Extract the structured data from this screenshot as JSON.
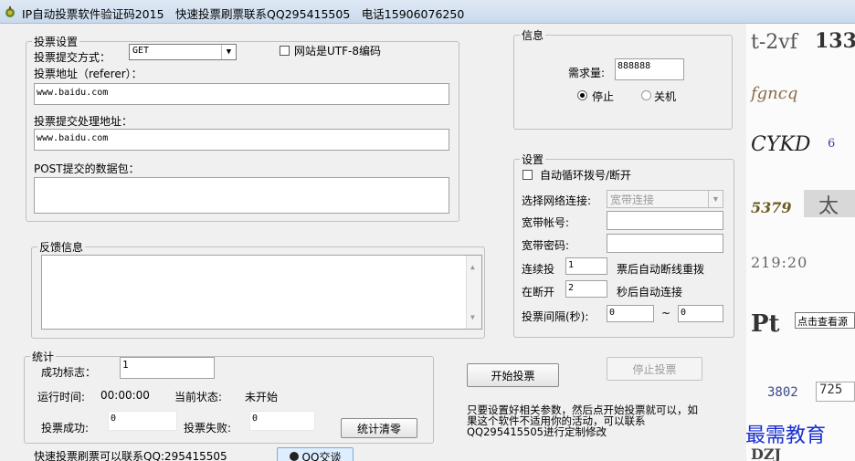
{
  "window": {
    "title": "IP自动投票软件验证码2015　快速投票刷票联系QQ295415505　电话15906076250"
  },
  "vote_settings": {
    "legend": "投票设置",
    "submit_method_label": "投票提交方式：",
    "submit_method_value": "GET",
    "utf8_label": "网站是UTF-8编码",
    "referer_label": "投票地址（referer）：",
    "referer_value": "www.baidu.com",
    "handler_label": "投票提交处理地址：",
    "handler_value": "www.baidu.com",
    "post_label": "POST提交的数据包：",
    "post_value": ""
  },
  "feedback": {
    "legend": "反馈信息",
    "content": ""
  },
  "stats": {
    "legend": "统计",
    "success_flag_label": "成功标志：",
    "success_flag_value": "1",
    "runtime_label": "运行时间:",
    "runtime_value": "00:00:00",
    "status_label": "当前状态:",
    "status_value": "未开始",
    "success_count_label": "投票成功:",
    "success_count_value": "0",
    "fail_count_label": "投票失败:",
    "fail_count_value": "0",
    "clear_button": "统计清零"
  },
  "info": {
    "legend": "信息",
    "demand_label": "需求量:",
    "demand_value": "888888",
    "stop_label": "停止",
    "shutdown_label": "关机"
  },
  "settings": {
    "legend": "设置",
    "auto_dial_label": "自动循环拨号/断开",
    "network_label": "选择网络连接:",
    "network_value": "宽带连接",
    "account_label": "宽带帐号:",
    "account_value": "",
    "password_label": "宽带密码:",
    "password_value": "",
    "continuous_label": "连续投",
    "continuous_value": "1",
    "continuous_suffix": "票后自动断线重拨",
    "reconnect_label": "在断开",
    "reconnect_value": "2",
    "reconnect_suffix": "秒后自动连接",
    "interval_label": "投票间隔(秒):",
    "interval_from": "0",
    "interval_sep": "~",
    "interval_to": "0"
  },
  "actions": {
    "start_button": "开始投票",
    "stop_button": "停止投票",
    "note": "只要设置好相关参数，然后点开始投票就可以，如果这个软件不适用你的活动，可以联系QQ295415505进行定制修改"
  },
  "footer": {
    "contact": "快速投票刷票可以联系QQ:295415505",
    "qq_button": "QQ交谈"
  },
  "captchas": {
    "items": [
      "t-2vf",
      "133",
      "fgncq",
      "CYKD",
      "6",
      "5379",
      "太",
      "219:20",
      "Pt"
    ],
    "tooltip": "点击查看源",
    "bottom_left": "3802",
    "bottom_right": "725",
    "last": "DZJ"
  },
  "watermark": "最需教育"
}
